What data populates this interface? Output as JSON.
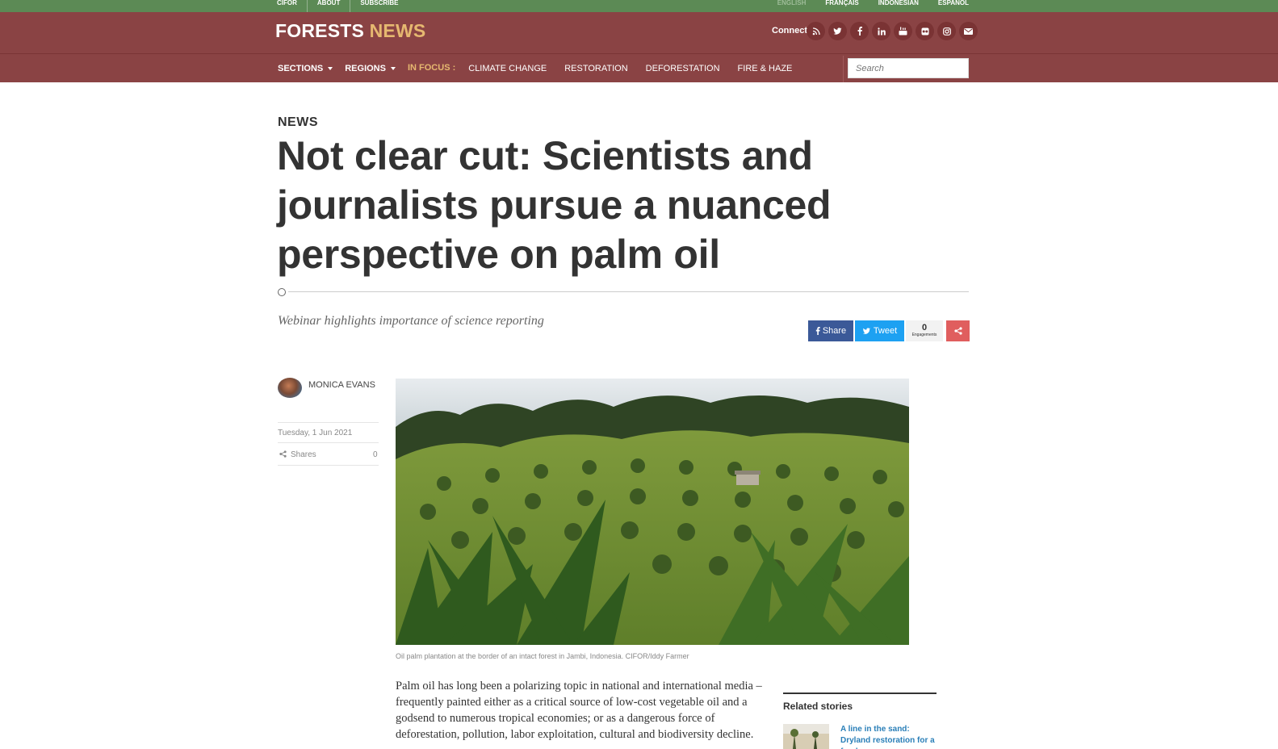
{
  "topbar": {
    "left_links": [
      "CIFOR",
      "ABOUT",
      "SUBSCRIBE"
    ],
    "languages": [
      {
        "label": "ENGLISH",
        "active": true
      },
      {
        "label": "FRANÇAIS",
        "active": false
      },
      {
        "label": "INDONESIAN",
        "active": false
      },
      {
        "label": "ESPAÑOL",
        "active": false
      }
    ]
  },
  "header": {
    "logo_part1": "FORESTS",
    "logo_part2": "NEWS",
    "connect_label": "Connect:",
    "social_icons": [
      "rss-icon",
      "twitter-icon",
      "facebook-icon",
      "linkedin-icon",
      "youtube-icon",
      "flickr-icon",
      "instagram-icon",
      "email-icon"
    ]
  },
  "nav": {
    "sections_label": "SECTIONS",
    "regions_label": "REGIONS",
    "in_focus_label": "IN FOCUS :",
    "topics": [
      "CLIMATE CHANGE",
      "RESTORATION",
      "DEFORESTATION",
      "FIRE & HAZE"
    ],
    "search_placeholder": "Search"
  },
  "article": {
    "category": "NEWS",
    "title": "Not clear cut: Scientists and journalists pursue a nuanced perspective on palm oil",
    "subtitle": "Webinar highlights importance of science reporting",
    "author": "MONICA EVANS",
    "date": "Tuesday, 1 Jun 2021",
    "shares_label": "Shares",
    "shares_count": "0",
    "image_caption": "Oil palm plantation at the border of an intact forest in Jambi, Indonesia. CIFOR/Iddy Farmer",
    "body_text": "Palm oil has long been a polarizing topic in national and international media –  frequently painted either as a critical source of low-cost vegetable oil and a godsend to numerous tropical economies; or as a dangerous force of deforestation, pollution, labor exploitation, cultural and biodiversity decline."
  },
  "share": {
    "facebook_label": "Share",
    "twitter_label": "Tweet",
    "engagements_count": "0",
    "engagements_label": "Engagements"
  },
  "related": {
    "heading": "Related stories",
    "first_story": "A line in the sand: Dryland restoration for a food"
  },
  "colors": {
    "topbar_green": "#5c8a55",
    "header_maroon": "#8a4344",
    "logo_accent": "#e6b870",
    "facebook_blue": "#3b5998",
    "twitter_blue": "#1da1f2",
    "share_red": "#e05e5e",
    "link_blue": "#2a7fb8"
  }
}
